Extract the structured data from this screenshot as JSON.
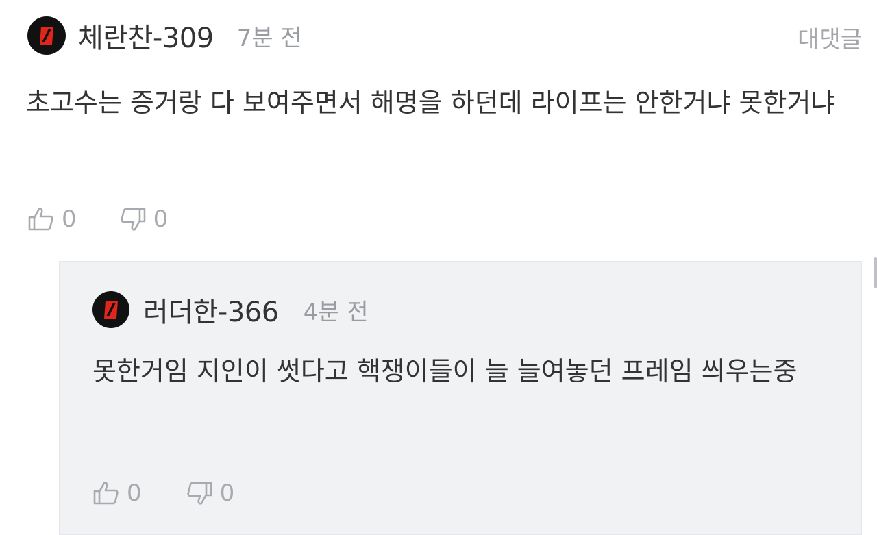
{
  "comment": {
    "username": "체란찬-309",
    "time": "7분 전",
    "reply_label": "대댓글",
    "text": "초고수는 증거랑 다 보여주면서 해명을 하던데 라이프는 안한거냐 못한거냐",
    "likes": "0",
    "dislikes": "0",
    "avatar_icon": "brand-logo-icon",
    "like_icon": "thumbs-up-icon",
    "dislike_icon": "thumbs-down-icon"
  },
  "reply": {
    "username": "러더한-366",
    "time": "4분 전",
    "text": "못한거임 지인이 썻다고 핵쟁이들이 늘 늘여놓던 프레임 씌우는중",
    "likes": "0",
    "dislikes": "0",
    "avatar_icon": "brand-logo-icon",
    "like_icon": "thumbs-up-icon",
    "dislike_icon": "thumbs-down-icon"
  },
  "colors": {
    "avatar_bg": "#111111",
    "avatar_accent": "#e0261c",
    "text": "#333333",
    "muted": "#9a9ca3",
    "reply_bg": "#f1f2f4"
  }
}
